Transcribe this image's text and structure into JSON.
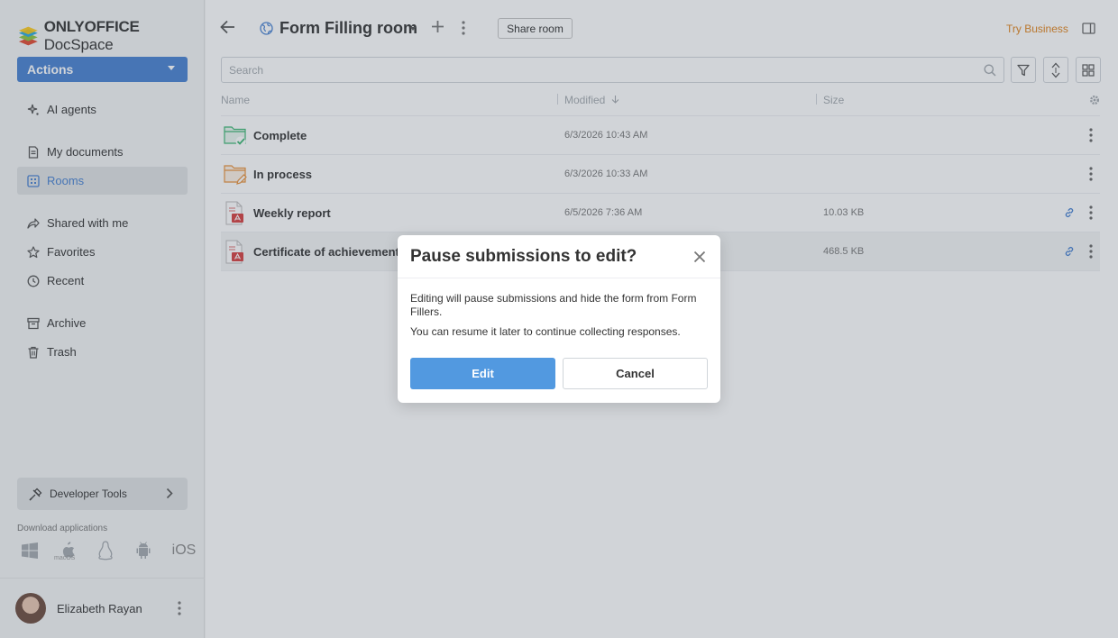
{
  "brand": {
    "bold": "ONLYOFFICE",
    "rest": " DocSpace"
  },
  "sidebar": {
    "actions_label": "Actions",
    "items": [
      {
        "label": "AI agents",
        "icon": "ai-agents-icon"
      },
      {
        "label": "My documents",
        "icon": "document-icon"
      },
      {
        "label": "Rooms",
        "icon": "rooms-icon",
        "active": true
      },
      {
        "label": "Shared with me",
        "icon": "share-icon"
      },
      {
        "label": "Favorites",
        "icon": "star-icon"
      },
      {
        "label": "Recent",
        "icon": "clock-icon"
      },
      {
        "label": "Archive",
        "icon": "archive-icon"
      },
      {
        "label": "Trash",
        "icon": "trash-icon"
      }
    ],
    "dev_tools_label": "Developer Tools",
    "download_label": "Download applications",
    "macos_label": "macOS",
    "ios_label": "iOS",
    "user_name": "Elizabeth Rayan"
  },
  "header": {
    "room_title": "Form Filling room",
    "share_room_label": "Share room",
    "try_business_label": "Try Business"
  },
  "search": {
    "placeholder": "Search"
  },
  "table": {
    "columns": {
      "name": "Name",
      "modified": "Modified",
      "size": "Size"
    },
    "rows": [
      {
        "name": "Complete",
        "modified": "6/3/2026 10:43 AM",
        "size": ""
      },
      {
        "name": "In process",
        "modified": "6/3/2026 10:33 AM",
        "size": ""
      },
      {
        "name": "Weekly report",
        "modified": "6/5/2026 7:36 AM",
        "size": "10.03 KB"
      },
      {
        "name": "Certificate of achievement",
        "modified": "",
        "size": "468.5 KB"
      }
    ]
  },
  "dialog": {
    "title": "Pause submissions to edit?",
    "body1": "Editing will pause submissions and hide the form from Form Fillers.",
    "body2": "You can resume it later to continue collecting responses.",
    "edit_label": "Edit",
    "cancel_label": "Cancel"
  },
  "colors": {
    "accent": "#4781d1",
    "edit_button": "#5299e0",
    "try_business": "#e0831d"
  }
}
